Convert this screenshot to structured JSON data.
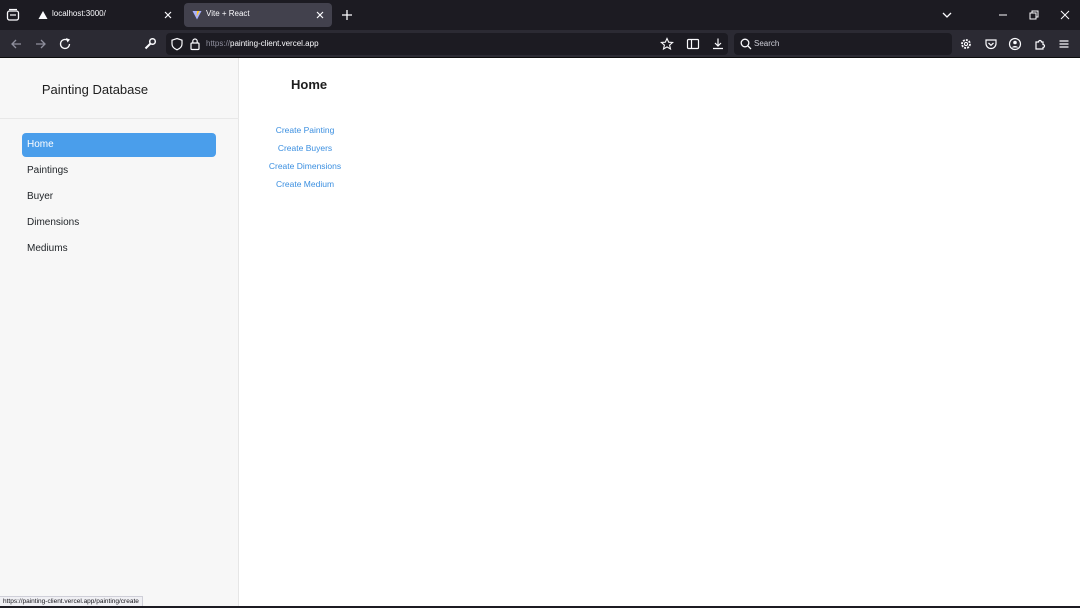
{
  "browser": {
    "tabs": [
      {
        "title": "localhost:3000/",
        "active": false
      },
      {
        "title": "Vite + React",
        "active": true
      }
    ],
    "url_scheme": "https://",
    "url_host": "painting-client.vercel.app",
    "search_placeholder": "Search",
    "status_url": "https://painting-client.vercel.app/painting/create",
    "colors": {
      "tabbar": "#1c1b22",
      "toolbar": "#2b2a33",
      "active_tab": "#42414d"
    }
  },
  "sidebar": {
    "brand": "Painting Database",
    "items": [
      {
        "label": "Home",
        "active": true
      },
      {
        "label": "Paintings",
        "active": false
      },
      {
        "label": "Buyer",
        "active": false
      },
      {
        "label": "Dimensions",
        "active": false
      },
      {
        "label": "Mediums",
        "active": false
      }
    ],
    "accent": "#4a9eeb"
  },
  "main": {
    "title": "Home",
    "links": [
      "Create Painting",
      "Create Buyers",
      "Create Dimensions",
      "Create Medium"
    ],
    "link_color": "#3b8fe0"
  },
  "icons": {
    "tab_manager": "tab-manager-icon",
    "localhost_favicon": "triangle-favicon-icon",
    "vite_favicon": "vite-favicon-icon",
    "close": "close-icon",
    "new_tab": "plus-icon",
    "back": "back-arrow-icon",
    "forward": "forward-arrow-icon",
    "reload": "reload-icon",
    "tools": "wrench-icon",
    "tracking": "shield-icon",
    "lock": "lock-icon",
    "bookmark": "star-icon",
    "search": "search-icon"
  }
}
